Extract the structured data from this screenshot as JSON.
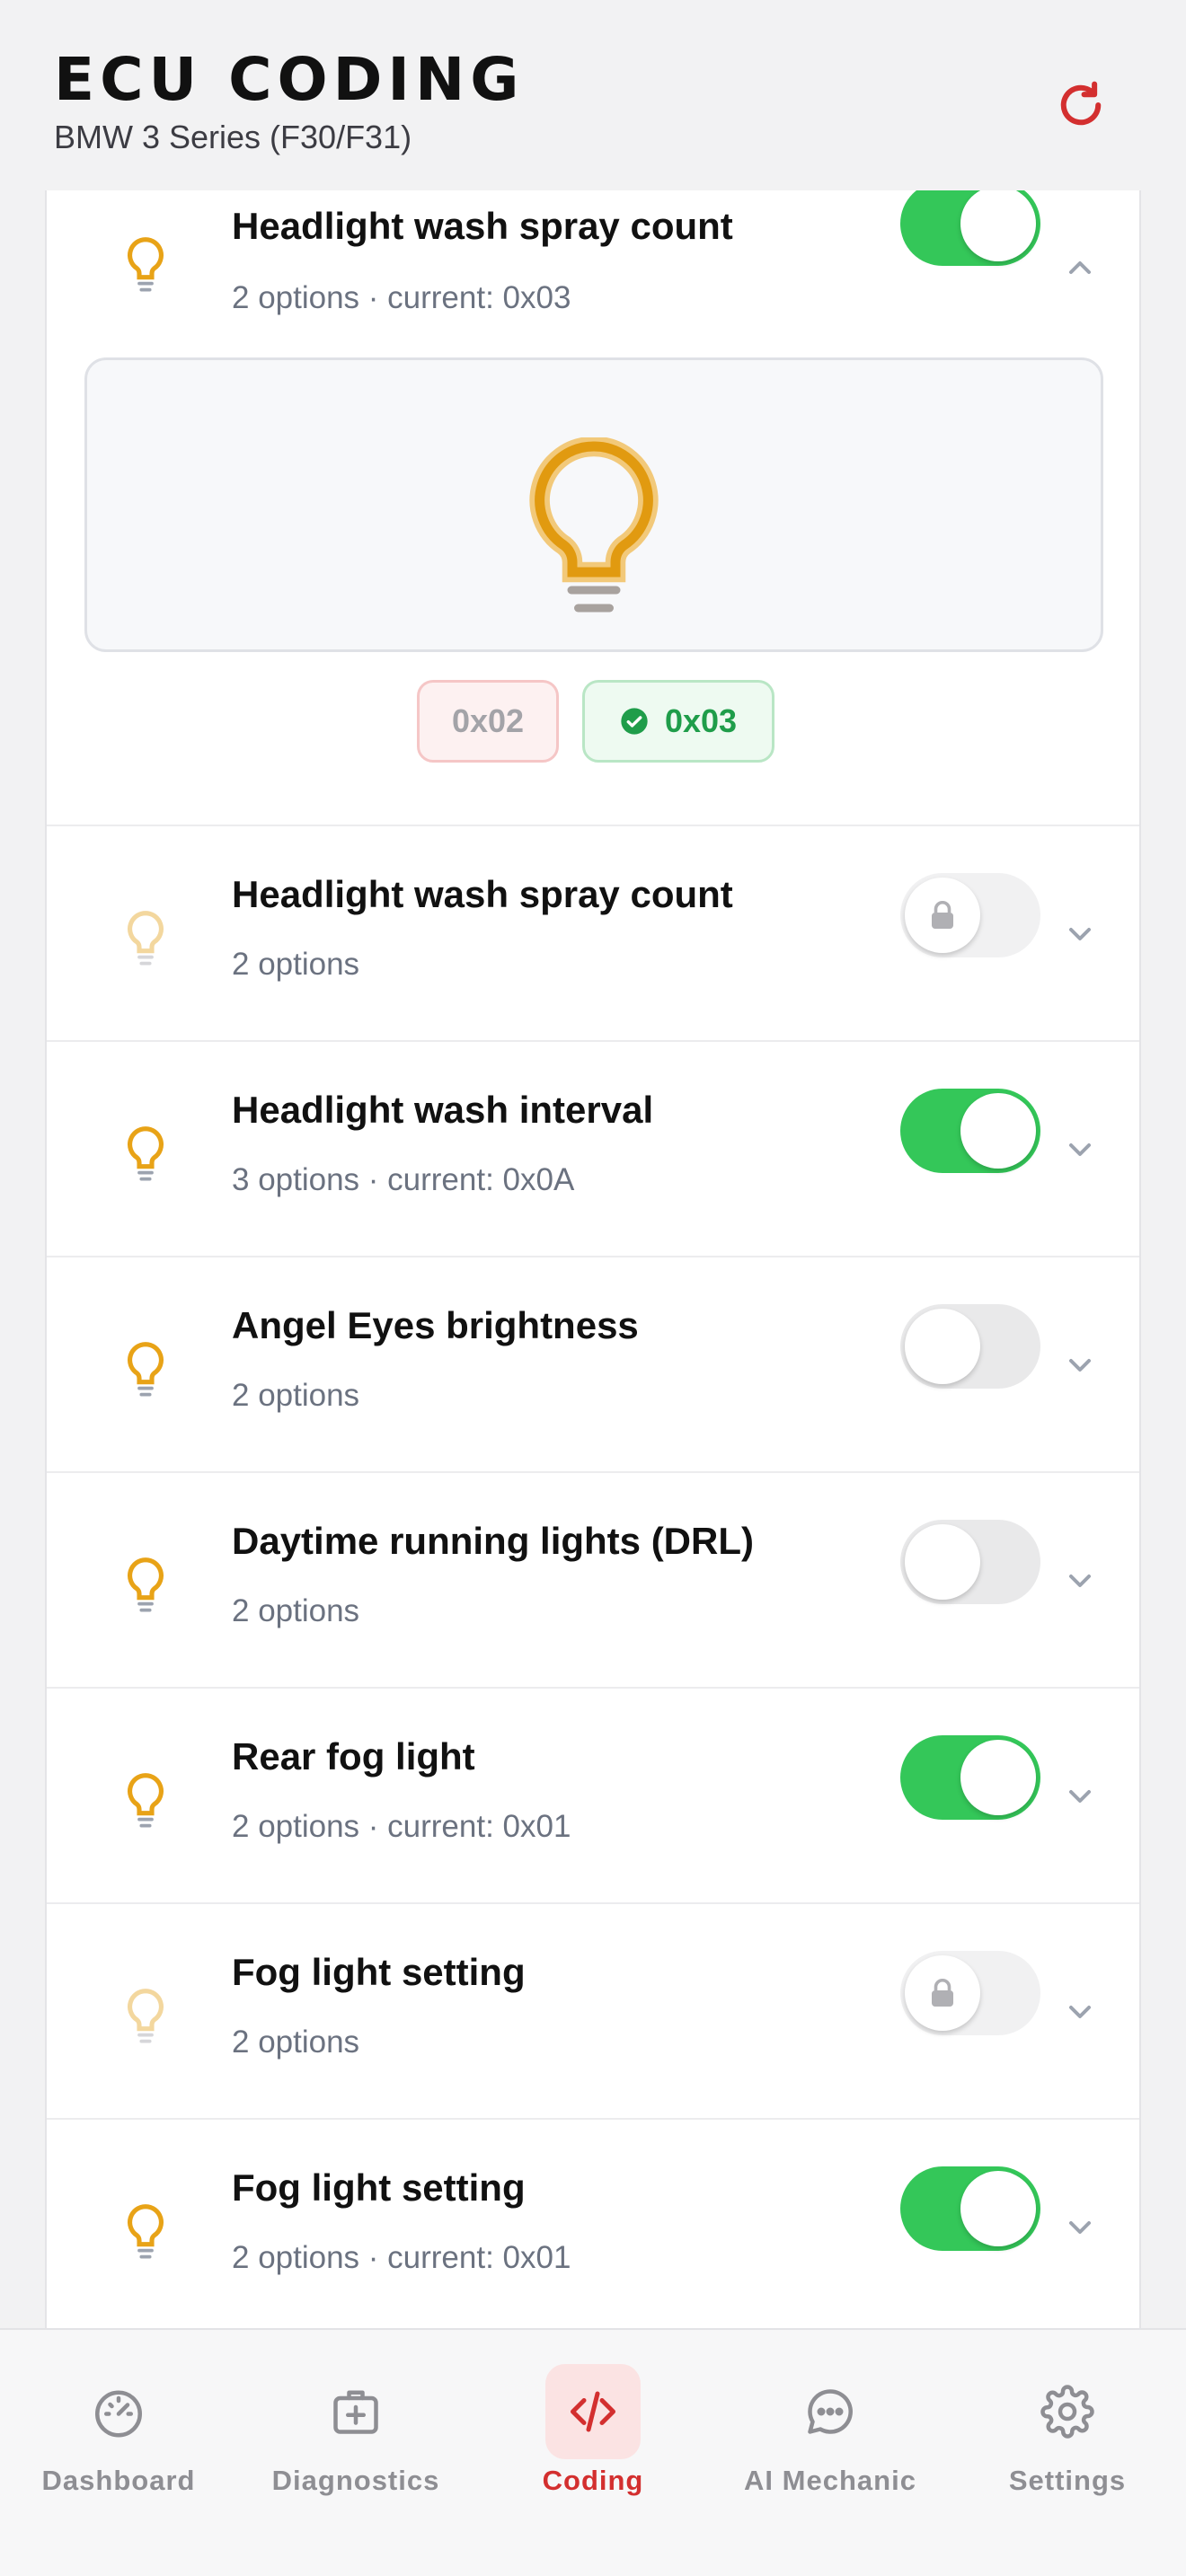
{
  "header": {
    "title": "ECU CODING",
    "subtitle": "BMW 3 Series (F30/F31)",
    "refresh_icon": "refresh-icon"
  },
  "colors": {
    "accent": "#d32f2f",
    "toggle_on": "#34c759",
    "bulb": "#e8a317",
    "selected_option": "#1f9d4a"
  },
  "expanded": {
    "options": [
      {
        "label": "0x02",
        "selected": false
      },
      {
        "label": "0x03",
        "selected": true
      }
    ]
  },
  "rows": [
    {
      "title": "Headlight wash spray count",
      "subtitle": "2 options · current: 0x03",
      "toggle": "on",
      "expanded": true
    },
    {
      "title": "Headlight wash spray count",
      "subtitle": "2 options",
      "toggle": "locked",
      "expanded": false
    },
    {
      "title": "Headlight wash interval",
      "subtitle": "3 options · current: 0x0A",
      "toggle": "on",
      "expanded": false
    },
    {
      "title": "Angel Eyes brightness",
      "subtitle": "2 options",
      "toggle": "off",
      "expanded": false
    },
    {
      "title": "Daytime running lights (DRL)",
      "subtitle": "2 options",
      "toggle": "off",
      "expanded": false
    },
    {
      "title": "Rear fog light",
      "subtitle": "2 options · current: 0x01",
      "toggle": "on",
      "expanded": false
    },
    {
      "title": "Fog light setting",
      "subtitle": "2 options",
      "toggle": "locked",
      "expanded": false
    },
    {
      "title": "Fog light setting",
      "subtitle": "2 options · current: 0x01",
      "toggle": "on",
      "expanded": false
    }
  ],
  "tabs": [
    {
      "label": "Dashboard",
      "icon": "gauge-icon",
      "active": false
    },
    {
      "label": "Diagnostics",
      "icon": "medkit-icon",
      "active": false
    },
    {
      "label": "Coding",
      "icon": "code-icon",
      "active": true
    },
    {
      "label": "AI Mechanic",
      "icon": "chat-icon",
      "active": false
    },
    {
      "label": "Settings",
      "icon": "gear-icon",
      "active": false
    }
  ]
}
